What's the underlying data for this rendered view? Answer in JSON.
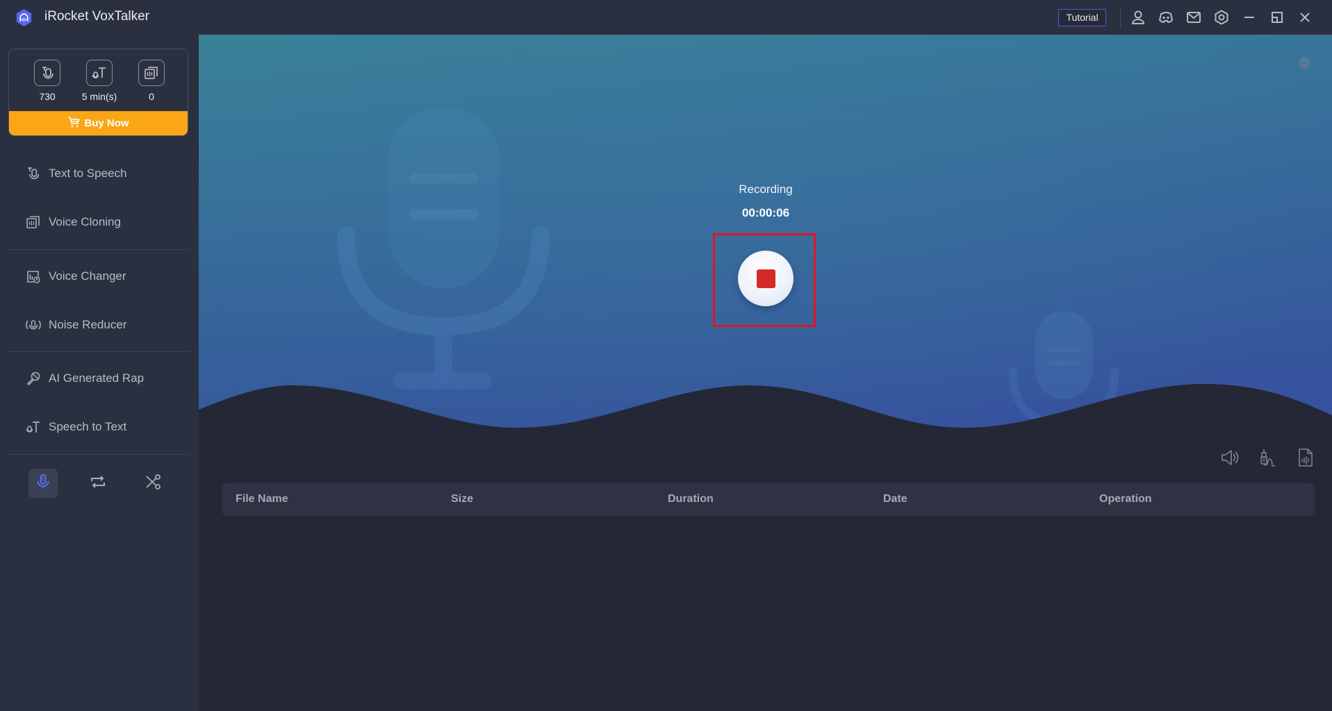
{
  "app": {
    "title": "iRocket VoxTalker",
    "accent_color": "#5865f2"
  },
  "titlebar": {
    "tutorial_label": "Tutorial",
    "icons": [
      "user-icon",
      "discord-icon",
      "mail-icon",
      "settings-icon",
      "minimize-icon",
      "restore-icon",
      "close-icon"
    ]
  },
  "stats": {
    "items": [
      {
        "icon": "text-to-speech-icon",
        "value": "730"
      },
      {
        "icon": "speech-to-text-icon",
        "value": "5 min(s)"
      },
      {
        "icon": "voice-cloning-icon",
        "value": "0"
      }
    ],
    "buy_label": "Buy Now",
    "buy_color": "#fba615"
  },
  "sidebar": {
    "items": [
      {
        "label": "Text to Speech",
        "icon": "text-to-speech-icon"
      },
      {
        "label": "Voice Cloning",
        "icon": "voice-cloning-icon"
      },
      {
        "label": "Voice Changer",
        "icon": "voice-changer-icon"
      },
      {
        "label": "Noise Reducer",
        "icon": "noise-reducer-icon"
      },
      {
        "label": "AI Generated Rap",
        "icon": "microphone-rap-icon"
      },
      {
        "label": "Speech to Text",
        "icon": "speech-to-text-icon"
      }
    ],
    "tools": [
      {
        "name": "recorder",
        "icon": "microphone-icon",
        "active": true
      },
      {
        "name": "converter",
        "icon": "repeat-icon",
        "active": false
      },
      {
        "name": "cutter",
        "icon": "scissors-icon",
        "active": false
      }
    ]
  },
  "recorder": {
    "status": "Recording",
    "elapsed": "00:00:06",
    "stop_color": "#d42a2a",
    "highlight_color": "#e3161e"
  },
  "actions": [
    "speaker-icon",
    "audio-jack-icon",
    "audio-file-icon"
  ],
  "table": {
    "columns": [
      "File Name",
      "Size",
      "Duration",
      "Date",
      "Operation"
    ],
    "rows": []
  }
}
